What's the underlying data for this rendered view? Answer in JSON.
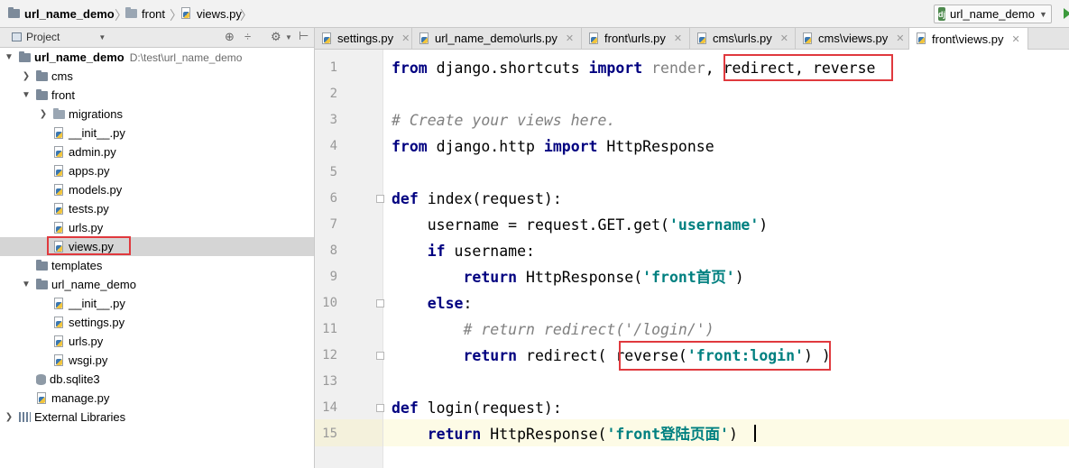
{
  "breadcrumb": [
    "url_name_demo",
    "front",
    "views.py"
  ],
  "run_config": {
    "label": "url_name_demo",
    "icon": "django-icon"
  },
  "project_panel": {
    "title": "Project"
  },
  "tree": [
    {
      "label": "url_name_demo",
      "path": "D:\\test\\url_name_demo",
      "depth": 0,
      "arrow": "v",
      "icon": "folder-icon"
    },
    {
      "label": "cms",
      "depth": 1,
      "arrow": ">",
      "icon": "folder-icon"
    },
    {
      "label": "front",
      "depth": 1,
      "arrow": "v",
      "icon": "folder-icon"
    },
    {
      "label": "migrations",
      "depth": 2,
      "arrow": ">",
      "icon": "folder-icon"
    },
    {
      "label": "__init__.py",
      "depth": 2,
      "icon": "python-file-icon"
    },
    {
      "label": "admin.py",
      "depth": 2,
      "icon": "python-file-icon"
    },
    {
      "label": "apps.py",
      "depth": 2,
      "icon": "python-file-icon"
    },
    {
      "label": "models.py",
      "depth": 2,
      "icon": "python-file-icon"
    },
    {
      "label": "tests.py",
      "depth": 2,
      "icon": "python-file-icon"
    },
    {
      "label": "urls.py",
      "depth": 2,
      "icon": "python-file-icon"
    },
    {
      "label": "views.py",
      "depth": 2,
      "icon": "python-file-icon",
      "selected": true
    },
    {
      "label": "templates",
      "depth": 1,
      "icon": "folder-icon"
    },
    {
      "label": "url_name_demo",
      "depth": 1,
      "arrow": "v",
      "icon": "folder-icon"
    },
    {
      "label": "__init__.py",
      "depth": 2,
      "icon": "python-file-icon"
    },
    {
      "label": "settings.py",
      "depth": 2,
      "icon": "python-file-icon"
    },
    {
      "label": "urls.py",
      "depth": 2,
      "icon": "python-file-icon"
    },
    {
      "label": "wsgi.py",
      "depth": 2,
      "icon": "python-file-icon"
    },
    {
      "label": "db.sqlite3",
      "depth": 1,
      "icon": "database-icon"
    },
    {
      "label": "manage.py",
      "depth": 1,
      "icon": "python-file-icon"
    },
    {
      "label": "External Libraries",
      "depth": 0,
      "arrow": ">",
      "icon": "library-icon"
    }
  ],
  "tabs": [
    {
      "label": "settings.py"
    },
    {
      "label": "url_name_demo\\urls.py"
    },
    {
      "label": "front\\urls.py"
    },
    {
      "label": "cms\\urls.py"
    },
    {
      "label": "cms\\views.py"
    },
    {
      "label": "front\\views.py",
      "active": true
    }
  ],
  "code_lines": [
    {
      "n": "1",
      "tokens": [
        {
          "t": "from",
          "c": "kw"
        },
        {
          "t": " django.shortcuts "
        },
        {
          "t": "import",
          "c": "kw"
        },
        {
          "t": " render",
          "c": "dim"
        },
        {
          "t": ", redirect, reverse"
        }
      ]
    },
    {
      "n": "2",
      "tokens": []
    },
    {
      "n": "3",
      "tokens": [
        {
          "t": "# Create your views here.",
          "c": "cmt"
        }
      ]
    },
    {
      "n": "4",
      "tokens": [
        {
          "t": "from",
          "c": "kw"
        },
        {
          "t": " django.http "
        },
        {
          "t": "import",
          "c": "kw"
        },
        {
          "t": " HttpResponse"
        }
      ]
    },
    {
      "n": "5",
      "tokens": []
    },
    {
      "n": "6",
      "tokens": [
        {
          "t": "def",
          "c": "kw"
        },
        {
          "t": " index(request):"
        }
      ]
    },
    {
      "n": "7",
      "tokens": [
        {
          "t": "    username = request.GET.get("
        },
        {
          "t": "'username'",
          "c": "str"
        },
        {
          "t": ")"
        }
      ]
    },
    {
      "n": "8",
      "tokens": [
        {
          "t": "    "
        },
        {
          "t": "if",
          "c": "kw"
        },
        {
          "t": " username:"
        }
      ]
    },
    {
      "n": "9",
      "tokens": [
        {
          "t": "        "
        },
        {
          "t": "return",
          "c": "kw"
        },
        {
          "t": " HttpResponse("
        },
        {
          "t": "'front首页'",
          "c": "str"
        },
        {
          "t": ")"
        }
      ]
    },
    {
      "n": "10",
      "tokens": [
        {
          "t": "    "
        },
        {
          "t": "else",
          "c": "kw"
        },
        {
          "t": ":"
        }
      ]
    },
    {
      "n": "11",
      "tokens": [
        {
          "t": "        "
        },
        {
          "t": "# return redirect('/login/')",
          "c": "cmt"
        }
      ]
    },
    {
      "n": "12",
      "tokens": [
        {
          "t": "        "
        },
        {
          "t": "return",
          "c": "kw"
        },
        {
          "t": " redirect( reverse("
        },
        {
          "t": "'front:login'",
          "c": "str"
        },
        {
          "t": ") )"
        }
      ]
    },
    {
      "n": "13",
      "tokens": []
    },
    {
      "n": "14",
      "tokens": [
        {
          "t": "def",
          "c": "kw"
        },
        {
          "t": " login(request):"
        }
      ]
    },
    {
      "n": "15",
      "tokens": [
        {
          "t": "    "
        },
        {
          "t": "return",
          "c": "kw"
        },
        {
          "t": " HttpResponse("
        },
        {
          "t": "'front登陆页面'",
          "c": "str"
        },
        {
          "t": ")"
        }
      ]
    }
  ]
}
